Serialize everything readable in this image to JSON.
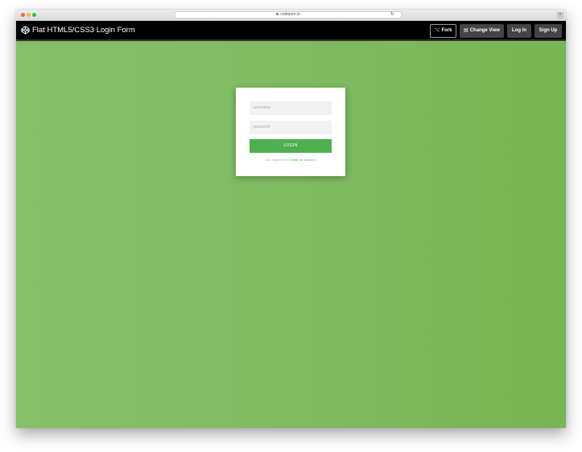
{
  "browser": {
    "url": "codepen.io",
    "reload_glyph": "↻",
    "corner_glyph": "+"
  },
  "header": {
    "title": "Flat HTML5/CSS3 Login Form",
    "fork_icon": "⌥",
    "fork_label": "Fork",
    "change_view_icon": "▤",
    "change_view_label": "Change View",
    "login_label": "Log In",
    "signup_label": "Sign Up"
  },
  "form": {
    "username_placeholder": "username",
    "password_placeholder": "password",
    "submit_label": "LOGIN",
    "register_prompt": "Not registered?",
    "register_link": "Create an account"
  },
  "colors": {
    "background_green": "#80bb62",
    "button_green": "#4caf50",
    "header_black": "#000000",
    "header_button_gray": "#444444"
  }
}
